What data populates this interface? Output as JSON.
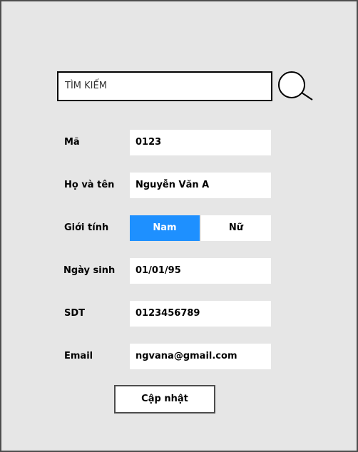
{
  "search": {
    "placeholder": "TÌM KIẾM"
  },
  "form": {
    "ma": {
      "label": "Mã",
      "value": "0123"
    },
    "ho_ten": {
      "label": "Họ và tên",
      "value": "Nguyễn Văn A"
    },
    "gioi_tinh": {
      "label": "Giới tính",
      "options": [
        "Nam",
        "Nữ"
      ],
      "selected": "Nam"
    },
    "ngay_sinh": {
      "label": "Ngày sinh",
      "value": "01/01/95"
    },
    "sdt": {
      "label": "SDT",
      "value": "0123456789"
    },
    "email": {
      "label": "Email",
      "value": "ngvana@gmail.com"
    }
  },
  "actions": {
    "update_label": "Cập nhật"
  },
  "colors": {
    "background": "#e6e6e6",
    "selected_toggle": "#1e90ff"
  }
}
